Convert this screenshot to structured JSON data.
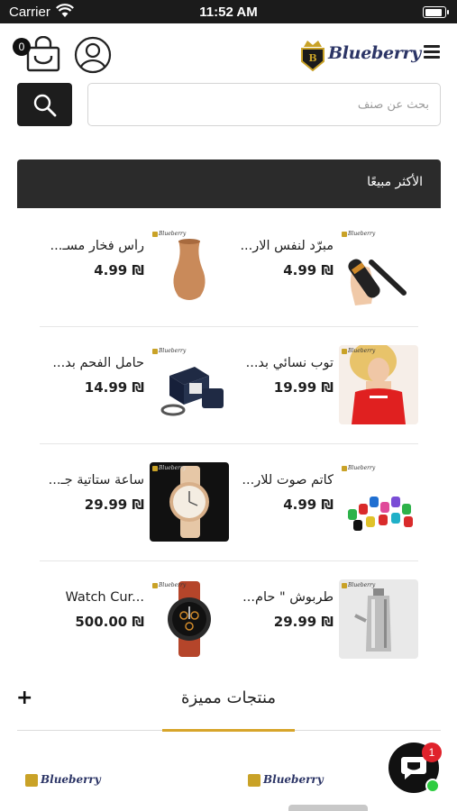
{
  "status_bar": {
    "carrier": "Carrier",
    "time": "11:52 AM",
    "battery_level": 0.9
  },
  "header": {
    "cart_count": "0",
    "logo_text": "Blueberry",
    "icons": [
      "cart-icon",
      "user-icon",
      "crown-logo-icon",
      "menu-icon"
    ]
  },
  "search": {
    "placeholder": "بحث عن صنف",
    "value": "",
    "button_icon": "search-icon"
  },
  "best_sellers": {
    "title": "الأكثر مبيعًا",
    "rows": [
      {
        "right": {
          "name": "مبرّد لنفس الار...",
          "price": "4.99 ₪",
          "image": "hand-cooler"
        },
        "left": {
          "name": "رأس فخار مسـ...",
          "price": "4.99 ₪",
          "image": "clay-bowl"
        }
      },
      {
        "right": {
          "name": "توب نسائي بد...",
          "price": "19.99 ₪",
          "image": "red-top"
        },
        "left": {
          "name": "حامل الفحم بد...",
          "price": "14.99 ₪",
          "image": "watch-box"
        }
      },
      {
        "right": {
          "name": "كاتم صوت للار...",
          "price": "4.99 ₪",
          "image": "colored-caps"
        },
        "left": {
          "name": "ساعة ستاتية جـ...",
          "price": "29.99 ₪",
          "image": "ladies-watch"
        }
      },
      {
        "right": {
          "name": "طربوش \" حام...",
          "price": "29.99 ₪",
          "image": "metal-shisha"
        },
        "left": {
          "name": "Watch Cur...",
          "price": "500.00 ₪",
          "image": "curren-watch"
        }
      }
    ],
    "brand_tag": "Blueberry"
  },
  "featured": {
    "title": "منتجات مميزة",
    "expand_icon": "plus-icon",
    "card_brand": "Blueberry"
  },
  "chat": {
    "badge": "1",
    "icon": "chat-bubble-icon"
  },
  "colors": {
    "accent": "#d7a52a",
    "dark": "#2b2b2b",
    "brand": "#2c3566",
    "badge": "#e0222b",
    "online": "#2ecc40"
  }
}
